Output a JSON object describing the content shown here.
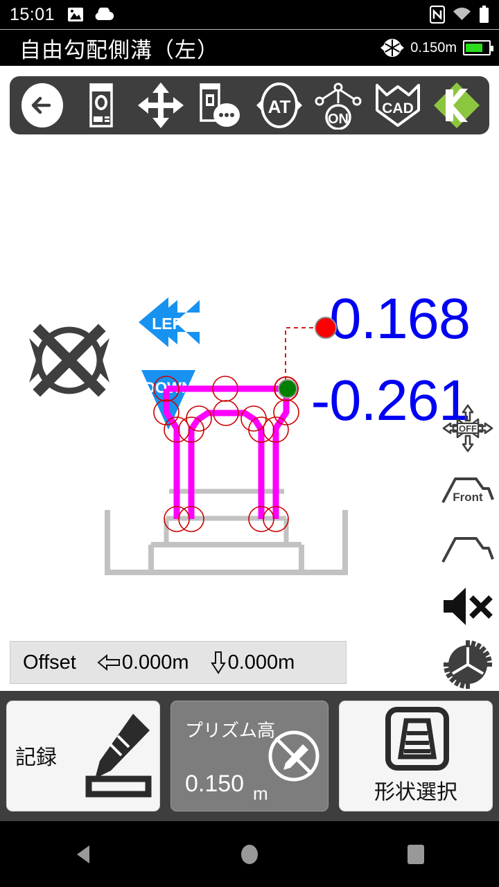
{
  "status_bar": {
    "time": "15:01",
    "icons": [
      "image-icon",
      "cloud-icon",
      "nfc-icon",
      "wifi-icon",
      "battery-icon"
    ]
  },
  "title_bar": {
    "title": "自由勾配側溝（左）",
    "prism_height": "0.150m",
    "prism_icon": "prism-target-icon",
    "battery_icon": "battery-full-icon"
  },
  "toolbar": {
    "items": [
      {
        "name": "back-button",
        "icon": "arrow-left-circle-icon",
        "label": ""
      },
      {
        "name": "instrument-button",
        "icon": "total-station-icon",
        "label": ""
      },
      {
        "name": "pan-move-button",
        "icon": "four-way-arrows-icon",
        "label": ""
      },
      {
        "name": "target-options-button",
        "icon": "instrument-dots-icon",
        "label": ""
      },
      {
        "name": "auto-tracking-button",
        "icon": "at-oval-icon",
        "label": "AT"
      },
      {
        "name": "laser-on-button",
        "icon": "laser-on-icon",
        "label": "ON"
      },
      {
        "name": "cad-button",
        "icon": "cad-shield-icon",
        "label": "CAD"
      },
      {
        "name": "kensetsu-logo-button",
        "icon": "k-diamond-logo-icon",
        "label": "K"
      }
    ]
  },
  "guidance": {
    "target_status_icon": "target-lost-x-icon",
    "horizontal_arrow": {
      "label": "LEFT",
      "direction": "left",
      "color": "#1792f0"
    },
    "vertical_arrow": {
      "label": "DOWN",
      "direction": "down",
      "color": "#1792f0"
    },
    "horizontal_value": "0.168",
    "vertical_value": "-0.261",
    "value_color": "#0000f2"
  },
  "cad_view": {
    "shape_color": "#ff00ff",
    "ground_color": "#c2c2c2",
    "node_color": "#cc0000",
    "current_point_color": "#008000",
    "prism_point_color": "#ff0000",
    "design_name": "自由勾配側溝"
  },
  "rail": {
    "items": [
      {
        "name": "auto-pan-off-button",
        "icon": "four-way-off-icon",
        "label": "OFF"
      },
      {
        "name": "front-view-button",
        "icon": "section-front-icon",
        "label": "Front"
      },
      {
        "name": "section-view-button",
        "icon": "section-icon",
        "label": ""
      },
      {
        "name": "sound-mute-button",
        "icon": "speaker-mute-icon",
        "label": ""
      },
      {
        "name": "settings-button",
        "icon": "gear-icon",
        "label": ""
      }
    ]
  },
  "offset": {
    "label": "Offset",
    "horizontal_icon": "arrow-left-offset-icon",
    "horizontal_value": "0.000m",
    "vertical_icon": "arrow-down-offset-icon",
    "vertical_value": "0.000m"
  },
  "actions": {
    "record": {
      "label": "記録",
      "icon": "pencil-record-icon"
    },
    "prism": {
      "label": "プリズム高",
      "value": "0.150",
      "unit": "m",
      "icon": "pencil-disabled-icon"
    },
    "shape": {
      "label": "形状選択",
      "icon": "trapezoid-shape-icon"
    }
  },
  "nav_bar": {
    "back": "nav-back-icon",
    "home": "nav-home-icon",
    "recent": "nav-recent-icon"
  }
}
